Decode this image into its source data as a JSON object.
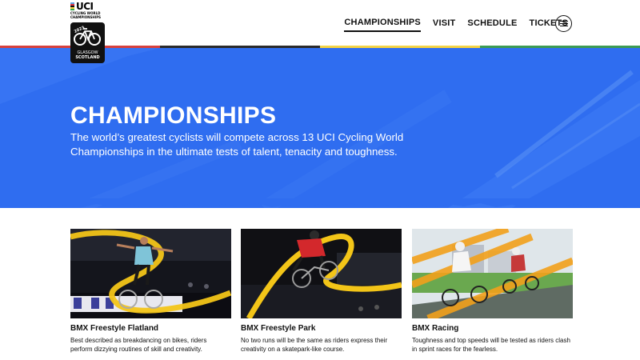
{
  "header": {
    "brand": "UCI",
    "brand_sub": "CYCLING WORLD\nCHAMPIONSHIPS",
    "badge_line1": "GLASGOW",
    "badge_line2": "SCOTLAND",
    "uci_colors": [
      "#5aa0e0",
      "#e0303c",
      "#111111",
      "#f6d23b",
      "#3aa651"
    ],
    "nav": [
      {
        "label": "CHAMPIONSHIPS",
        "active": true
      },
      {
        "label": "VISIT"
      },
      {
        "label": "SCHEDULE"
      },
      {
        "label": "TICKETS"
      }
    ],
    "menu_icon": "hamburger-icon"
  },
  "rainbow_colors": [
    "#d7403c",
    "#2a2a2a",
    "#f4d343",
    "#3b9b53"
  ],
  "hero": {
    "title": "CHAMPIONSHIPS",
    "text": "The world’s greatest cyclists will compete across 13 UCI Cycling World Championships in the ultimate tests of talent, tenacity and toughness.",
    "background": "#2f6df0"
  },
  "cards": [
    {
      "title": "BMX Freestyle Flatland",
      "description": "Best described as breakdancing on bikes, riders perform dizzying routines of skill and creativity."
    },
    {
      "title": "BMX Freestyle Park",
      "description": "No two runs will be the same as riders express their creativity on a skatepark-like course."
    },
    {
      "title": "BMX Racing",
      "description": "Toughness and top speeds will be tested as riders clash in sprint races for the fearless."
    }
  ]
}
